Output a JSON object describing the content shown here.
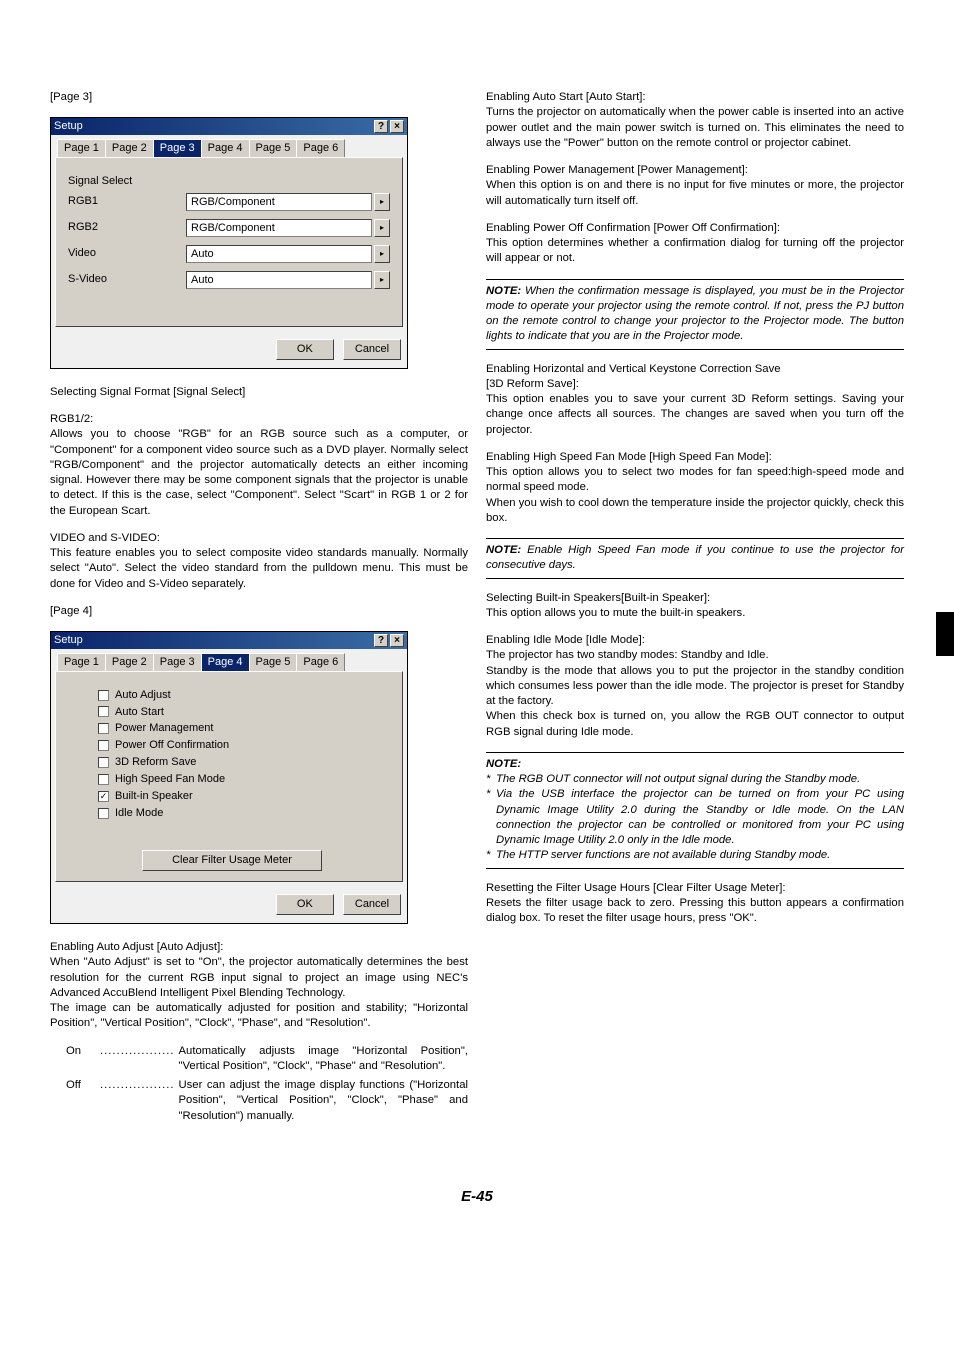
{
  "footer": "E-45",
  "left": {
    "page3_tag": "[Page 3]",
    "dialog3": {
      "title": "Setup",
      "tabs": [
        "Page 1",
        "Page 2",
        "Page 3",
        "Page 4",
        "Page 5",
        "Page 6"
      ],
      "active_tab": 2,
      "group_label": "Signal Select",
      "rows": [
        {
          "label": "RGB1",
          "value": "RGB/Component"
        },
        {
          "label": "RGB2",
          "value": "RGB/Component"
        },
        {
          "label": "Video",
          "value": "Auto"
        },
        {
          "label": "S-Video",
          "value": "Auto"
        }
      ],
      "ok": "OK",
      "cancel": "Cancel"
    },
    "sec1_title": "Selecting Signal Format [Signal Select]",
    "rgb_hd": "RGB1/2:",
    "rgb_body": "Allows you to choose \"RGB\" for an RGB source such as a computer, or \"Component\" for a component video source such as a DVD player. Normally select \"RGB/Component\" and the projector automatically detects an either incoming signal. However there may be some component signals that the projector is unable to detect. If this is the case, select \"Component\". Select \"Scart\" in RGB 1 or 2 for the European Scart.",
    "vid_hd": "VIDEO and S-VIDEO:",
    "vid_body": "This feature enables you to select composite video standards manually. Normally select \"Auto\". Select the video standard from the pulldown menu. This must be done for Video and S-Video separately.",
    "page4_tag": "[Page 4]",
    "dialog4": {
      "title": "Setup",
      "tabs": [
        "Page 1",
        "Page 2",
        "Page 3",
        "Page 4",
        "Page 5",
        "Page 6"
      ],
      "active_tab": 3,
      "checks": [
        {
          "label": "Auto Adjust",
          "checked": false
        },
        {
          "label": "Auto Start",
          "checked": false
        },
        {
          "label": "Power Management",
          "checked": false
        },
        {
          "label": "Power Off Confirmation",
          "checked": false
        },
        {
          "label": "3D Reform Save",
          "checked": false
        },
        {
          "label": "High Speed Fan Mode",
          "checked": false
        },
        {
          "label": "Built-in Speaker",
          "checked": true
        },
        {
          "label": "Idle Mode",
          "checked": false
        }
      ],
      "clear_btn": "Clear Filter Usage Meter",
      "ok": "OK",
      "cancel": "Cancel"
    },
    "aa_hd": "Enabling Auto Adjust [Auto Adjust]:",
    "aa_body1": "When \"Auto Adjust\" is set to \"On\", the projector automatically determines the best resolution for the current RGB input signal to project an image using NEC's Advanced AccuBlend Intelligent Pixel Blending Technology.",
    "aa_body2": "The image can be automatically adjusted for position and stability; \"Horizontal Position\", \"Vertical Position\", \"Clock\", \"Phase\", and \"Resolution\".",
    "terms": [
      {
        "term": "On",
        "dots": "..................",
        "desc": "Automatically adjusts image \"Horizontal Position\", \"Vertical Position\", \"Clock\", \"Phase\" and \"Resolution\"."
      },
      {
        "term": "Off",
        "dots": "..................",
        "desc": "User can adjust the image display functions (\"Horizontal Position\", \"Vertical Position\", \"Clock\", \"Phase\" and \"Resolution\") manually."
      }
    ]
  },
  "right": {
    "as_hd": "Enabling Auto Start [Auto Start]:",
    "as_body": "Turns the projector on automatically when the power cable is inserted into an active power outlet and the main power switch is turned on. This eliminates the need to always use the \"Power\" button on the remote control or projector cabinet.",
    "pm_hd": "Enabling Power Management [Power Management]:",
    "pm_body": "When this option is on and there is no input for five minutes or more, the projector will automatically turn itself off.",
    "pc_hd": "Enabling Power Off Confirmation [Power Off Confirmation]:",
    "pc_body": "This option determines whether a confirmation dialog for turning off the projector will appear or not.",
    "note1_hd": "NOTE:",
    "note1_body": " When the confirmation message is displayed, you must be in the Projector mode to operate your projector using the remote control. If not, press the PJ button on the remote control to change your projector to the Projector mode. The button lights to indicate that you are in the Projector mode.",
    "ks_hd1": "Enabling Horizontal and Vertical Keystone Correction Save",
    "ks_hd2": "[3D Reform Save]:",
    "ks_body": "This option enables you to save your current 3D Reform settings. Saving your change once affects all sources. The changes are saved when you turn off the projector.",
    "fan_hd": "Enabling High Speed Fan Mode [High Speed Fan Mode]:",
    "fan_body1": "This option allows you to select two modes for fan speed:high-speed mode and normal speed mode.",
    "fan_body2": "When you wish to cool down the temperature inside the projector quickly, check this box.",
    "note2_hd": "NOTE:",
    "note2_body": " Enable High Speed Fan mode if you continue to use the projector for consecutive days.",
    "spk_hd": "Selecting Built-in Speakers[Built-in Speaker]:",
    "spk_body": "This option allows you to mute the built-in speakers.",
    "idle_hd": "Enabling Idle Mode [Idle Mode]:",
    "idle_body1": "The projector has two standby modes: Standby and Idle.",
    "idle_body2": "Standby is the mode that allows you to put the projector in the standby condition which consumes less power than the idle mode. The projector is preset for Standby at the factory.",
    "idle_body3": "When this check box is turned on, you allow the RGB OUT connector to output RGB signal during Idle mode.",
    "note3_hd": "NOTE:",
    "note3_items": [
      "The RGB OUT connector will not output signal during the Standby mode.",
      "Via the USB interface the projector can be turned on from your PC using Dynamic Image Utility 2.0 during the Standby or Idle mode. On the LAN connection the projector can be controlled or monitored from your PC using Dynamic Image Utility 2.0 only in the Idle mode.",
      "The HTTP server functions are not available during Standby mode."
    ],
    "filter_hd": "Resetting the Filter Usage Hours [Clear Filter Usage Meter]:",
    "filter_body": "Resets the filter usage back to zero. Pressing this button appears a confirmation dialog box. To reset the filter usage hours, press \"OK\"."
  }
}
